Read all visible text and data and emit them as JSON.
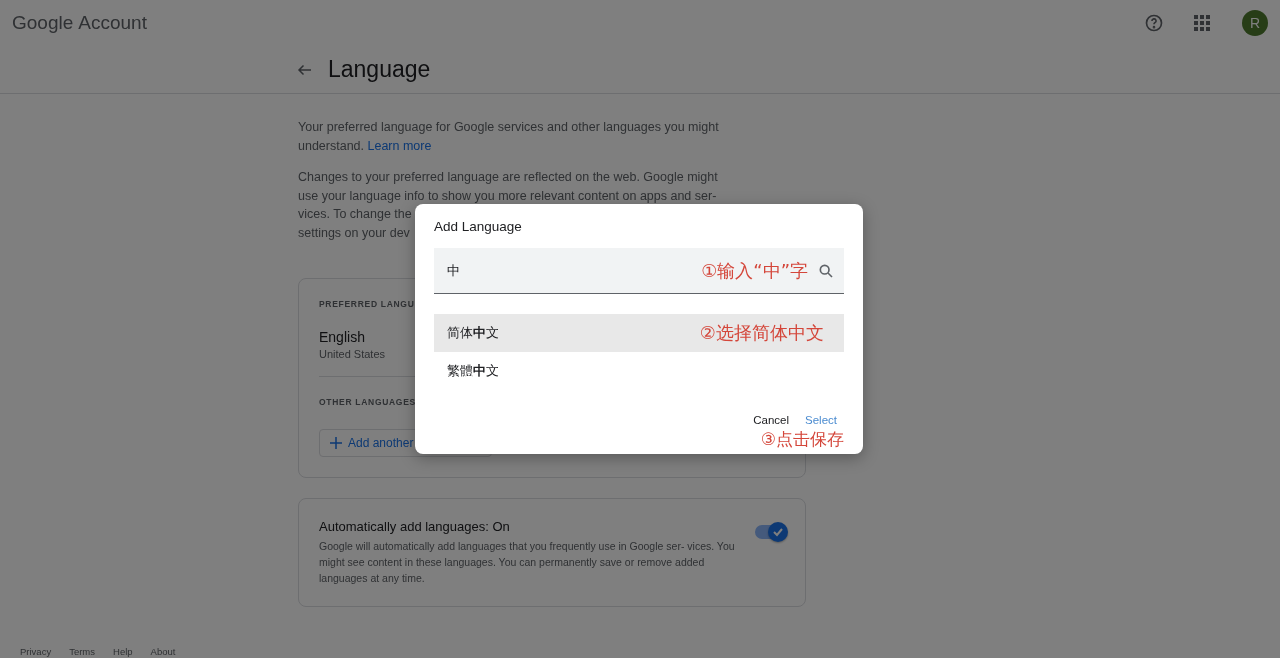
{
  "header": {
    "logo": "Google",
    "product": "Account",
    "avatar": "R"
  },
  "page": {
    "title": "Language"
  },
  "intro": {
    "text": "Your preferred language for Google services and other languages you might understand.",
    "link": "Learn more"
  },
  "changes": {
    "lines": [
      "Changes to your preferred language are reflected on the web. Google might",
      "use your language info to show you more relevant content on apps and ser-",
      "vices. To change the",
      "settings on your dev"
    ]
  },
  "preferred_card": {
    "heading": "PREFERRED LANGU",
    "language": "English",
    "region": "United States",
    "other_heading": "OTHER LANGUAGES",
    "add_button": "Add another"
  },
  "auto_card": {
    "title": "Automatically add languages: On",
    "description": "Google will automatically add languages that you frequently use in Google ser- vices. You might see content in these languages. You can permanently save or remove added languages at any time.",
    "on": true
  },
  "footer": [
    "Privacy",
    "Terms",
    "Help",
    "About"
  ],
  "dialog": {
    "title": "Add Language",
    "search": {
      "value": "中",
      "annotation": "①输入“中”字"
    },
    "options": [
      {
        "label": "简体**中**文",
        "selected": true,
        "annotation": "②选择简体中文"
      },
      {
        "label": "繁體**中**文",
        "selected": false
      }
    ],
    "buttons": [
      {
        "label": "Cancel",
        "kind": "secondary"
      },
      {
        "label": "Select",
        "kind": "primary"
      }
    ],
    "annotation": "③点击保存"
  }
}
